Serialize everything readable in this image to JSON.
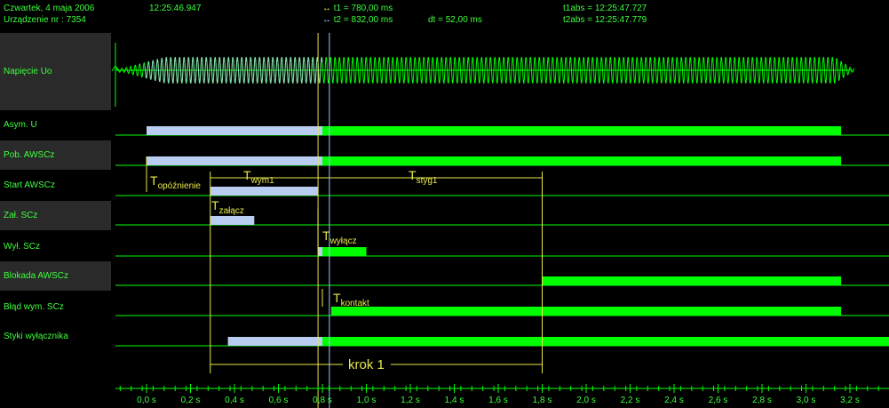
{
  "header": {
    "date": "Czwartek,  4  maja  2006",
    "device": "Urządzenie nr :  7354",
    "time": "12:25:46.947",
    "t1": "t1 = 780,00 ms",
    "t2": "t2 = 832,00 ms",
    "dt": "dt = 52,00 ms",
    "t1abs": "t1abs = 12:25:47.727",
    "t2abs": "t2abs = 12:25:47.779"
  },
  "colors": {
    "background": "#000000",
    "label_text": "#3cff3c",
    "signal_green": "#00ff00",
    "signal_blue": "#b8cdf0",
    "annotation": "#e8e84a",
    "cursor1": "#e8e84a",
    "cursor2": "#9fc4ff",
    "label_bg": "#2a2a2a"
  },
  "icons": {
    "cursor1": "double-arrow-yellow-icon",
    "cursor2": "double-arrow-cyan-icon"
  },
  "channels": [
    {
      "id": "napiecie",
      "label": "Napięcie Uo",
      "kind": "analog"
    },
    {
      "id": "asym",
      "label": "Asym. U",
      "kind": "digital",
      "segments": [
        {
          "from": 0.0,
          "to": 0.8,
          "color": "blue"
        },
        {
          "from": 0.8,
          "to": 3.16,
          "color": "green"
        }
      ]
    },
    {
      "id": "pob",
      "label": "Pob. AWSCz",
      "kind": "digital",
      "segments": [
        {
          "from": 0.0,
          "to": 0.8,
          "color": "blue"
        },
        {
          "from": 0.8,
          "to": 3.16,
          "color": "green"
        }
      ]
    },
    {
      "id": "start",
      "label": "Start AWSCz",
      "kind": "digital",
      "segments": [
        {
          "from": 0.29,
          "to": 0.78,
          "color": "blue"
        }
      ]
    },
    {
      "id": "zal",
      "label": "Zał. SCz",
      "kind": "digital",
      "segments": [
        {
          "from": 0.29,
          "to": 0.49,
          "color": "blue"
        }
      ]
    },
    {
      "id": "wyl",
      "label": "Wył. SCz",
      "kind": "digital",
      "segments": [
        {
          "from": 0.78,
          "to": 0.8,
          "color": "blue"
        },
        {
          "from": 0.8,
          "to": 1.0,
          "color": "green"
        }
      ]
    },
    {
      "id": "blokada",
      "label": "Blokada AWSCz",
      "kind": "digital",
      "segments": [
        {
          "from": 1.8,
          "to": 3.16,
          "color": "green"
        }
      ]
    },
    {
      "id": "blad",
      "label": "Błąd wym. SCz",
      "kind": "digital",
      "segments": [
        {
          "from": 0.84,
          "to": 3.16,
          "color": "green"
        }
      ]
    },
    {
      "id": "styki",
      "label": "Styki wyłącznika",
      "kind": "digital",
      "segments": [
        {
          "from": 0.37,
          "to": 0.8,
          "color": "blue"
        },
        {
          "from": 0.8,
          "to": 3.38,
          "color": "green"
        }
      ]
    }
  ],
  "axis": {
    "ticks": [
      {
        "v": 0.0,
        "label": "0,0 s"
      },
      {
        "v": 0.2,
        "label": "0,2 s"
      },
      {
        "v": 0.4,
        "label": "0,4 s"
      },
      {
        "v": 0.6,
        "label": "0,6 s"
      },
      {
        "v": 0.8,
        "label": "0,8 s"
      },
      {
        "v": 1.0,
        "label": "1,0 s"
      },
      {
        "v": 1.2,
        "label": "1,2 s"
      },
      {
        "v": 1.4,
        "label": "1,4 s"
      },
      {
        "v": 1.6,
        "label": "1,6 s"
      },
      {
        "v": 1.8,
        "label": "1,8 s"
      },
      {
        "v": 2.0,
        "label": "2,0 s"
      },
      {
        "v": 2.2,
        "label": "2,2 s"
      },
      {
        "v": 2.4,
        "label": "2,4 s"
      },
      {
        "v": 2.6,
        "label": "2,6 s"
      },
      {
        "v": 2.8,
        "label": "2,8 s"
      },
      {
        "v": 3.0,
        "label": "3,0 s"
      },
      {
        "v": 3.2,
        "label": "3,2 s"
      }
    ]
  },
  "cursors": [
    {
      "t": 0.78
    },
    {
      "t": 0.832
    }
  ],
  "annotations": {
    "opoznienie": {
      "main": "T",
      "sub": "opóźnienie"
    },
    "wym1": {
      "main": "T",
      "sub": "wym1"
    },
    "styg1": {
      "main": "T",
      "sub": "styg1"
    },
    "zalacz": {
      "main": "T",
      "sub": "załącz"
    },
    "wylacz": {
      "main": "T",
      "sub": "wyłącz"
    },
    "kontakt": {
      "main": "T",
      "sub": "kontakt"
    },
    "krok": "krok 1"
  }
}
